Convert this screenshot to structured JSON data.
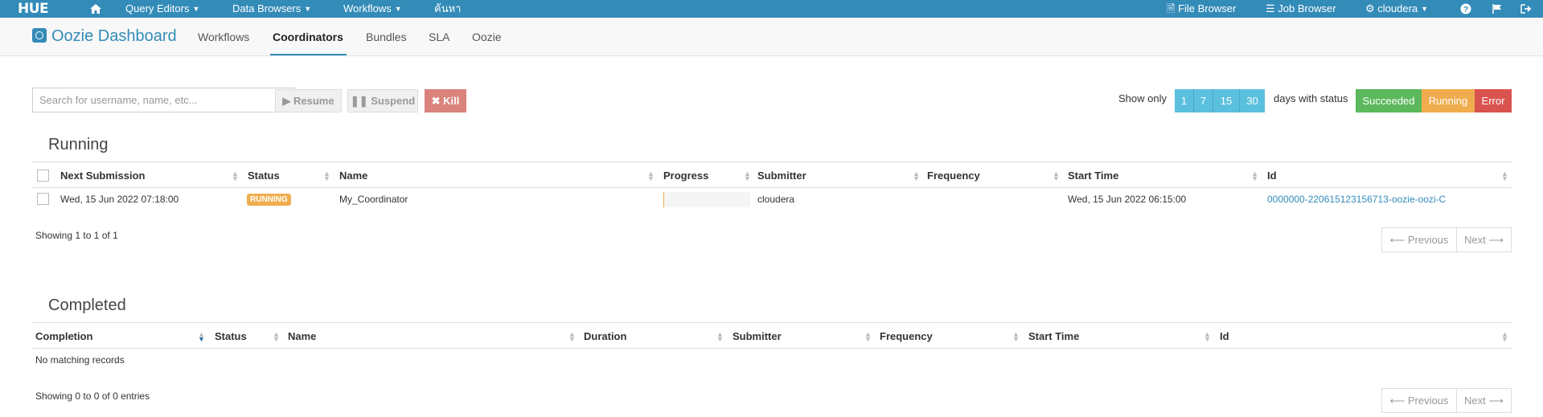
{
  "topbar": {
    "logo": "HUE",
    "home_icon": "home-icon",
    "menus": [
      "Query Editors",
      "Data Browsers",
      "Workflows"
    ],
    "search_link": "ค้นหา",
    "file_browser": "File Browser",
    "job_browser": "Job Browser",
    "user": "cloudera",
    "colors": {
      "bar": "#338bb8"
    }
  },
  "subnav": {
    "title": "Oozie Dashboard",
    "tabs": [
      "Workflows",
      "Coordinators",
      "Bundles",
      "SLA",
      "Oozie"
    ],
    "active_tab": "Coordinators"
  },
  "toolbar": {
    "search_placeholder": "Search for username, name, etc...",
    "resume": "Resume",
    "suspend": "Suspend",
    "kill": "Kill",
    "show_only": "Show only",
    "days": [
      "1",
      "7",
      "15",
      "30"
    ],
    "days_with_status": "days with status",
    "statuses": [
      {
        "label": "Succeeded",
        "color": "#5cb85c"
      },
      {
        "label": "Running",
        "color": "#f0ad4e"
      },
      {
        "label": "Error",
        "color": "#d9534f"
      }
    ]
  },
  "running": {
    "title": "Running",
    "headers": [
      "Next Submission",
      "Status",
      "Name",
      "Progress",
      "Submitter",
      "Frequency",
      "Start Time",
      "Id"
    ],
    "rows": [
      {
        "next_submission": "Wed, 15 Jun 2022 07:18:00",
        "status": "RUNNING",
        "name": "My_Coordinator",
        "progress": 0,
        "submitter": "cloudera",
        "frequency": "",
        "start_time": "Wed, 15 Jun 2022 06:15:00",
        "id": "0000000-220615123156713-oozie-oozi-C"
      }
    ],
    "info": "Showing 1 to 1 of 1",
    "prev": "Previous",
    "next": "Next"
  },
  "completed": {
    "title": "Completed",
    "headers": [
      "Completion",
      "Status",
      "Name",
      "Duration",
      "Submitter",
      "Frequency",
      "Start Time",
      "Id"
    ],
    "empty": "No matching records",
    "info": "Showing 0 to 0 of 0 entries",
    "prev": "Previous",
    "next": "Next"
  }
}
